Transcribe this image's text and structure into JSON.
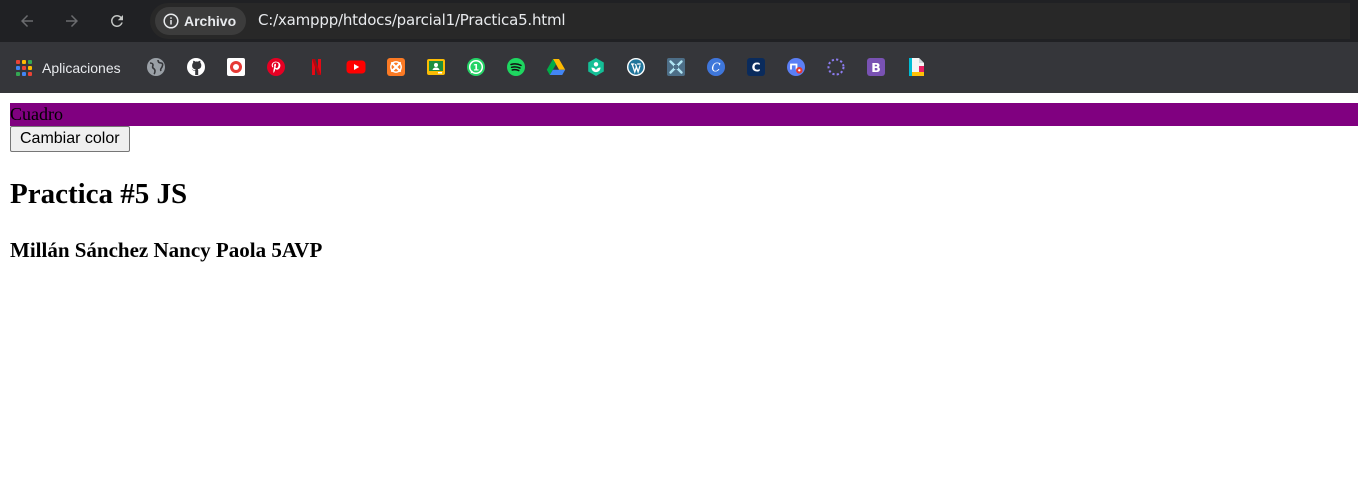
{
  "browser": {
    "security_chip_label": "Archivo",
    "url": "C:/xamppp/htdocs/parcial1/Practica5.html"
  },
  "bookmarks_bar": {
    "apps_label": "Aplicaciones",
    "items": [
      {
        "icon": "globe-icon"
      },
      {
        "icon": "github-icon"
      },
      {
        "icon": "record-icon"
      },
      {
        "icon": "pinterest-icon"
      },
      {
        "icon": "netflix-icon"
      },
      {
        "icon": "youtube-icon"
      },
      {
        "icon": "xampp-icon"
      },
      {
        "icon": "classroom-icon"
      },
      {
        "icon": "whatsapp-icon"
      },
      {
        "icon": "spotify-icon"
      },
      {
        "icon": "google-drive-icon"
      },
      {
        "icon": "khan-academy-icon"
      },
      {
        "icon": "wordpress-icon"
      },
      {
        "icon": "tools-icon"
      },
      {
        "icon": "canva-icon"
      },
      {
        "icon": "coursera-icon"
      },
      {
        "icon": "extension-icon"
      },
      {
        "icon": "dotted-circle-icon"
      },
      {
        "icon": "bootstrap-icon"
      },
      {
        "icon": "file-icon"
      }
    ]
  },
  "page": {
    "box_text": "Cuadro",
    "box_color": "#800080",
    "button_label": "Cambiar color",
    "heading": "Practica #5 JS",
    "subheading": "Millán Sánchez Nancy Paola 5AVP"
  }
}
